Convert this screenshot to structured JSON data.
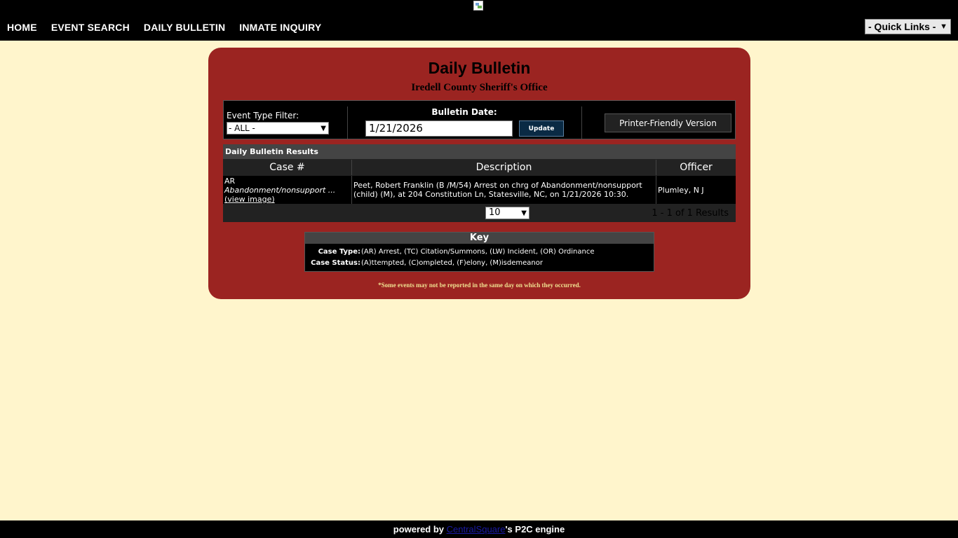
{
  "nav": {
    "items": [
      {
        "label": "HOME"
      },
      {
        "label": "EVENT SEARCH"
      },
      {
        "label": "DAILY BULLETIN"
      },
      {
        "label": "INMATE INQUIRY"
      }
    ],
    "quick_links": "- Quick Links -"
  },
  "panel": {
    "title": "Daily Bulletin",
    "subtitle": "Iredell County Sheriff's Office"
  },
  "filters": {
    "event_type_label": "Event Type Filter:",
    "event_type_value": "- ALL -",
    "bulletin_date_label": "Bulletin Date:",
    "bulletin_date_value": "1/21/2026",
    "update_label": "Update",
    "printer_label": "Printer-Friendly Version"
  },
  "results": {
    "title": "Daily Bulletin Results",
    "columns": [
      "Case #",
      "Description",
      "Officer"
    ],
    "rows": [
      {
        "case_code": "AR",
        "case_desc": "Abandonment/nonsupport ...",
        "case_link": "(view image)",
        "description": "Peet, Robert Franklin (B /M/54) Arrest on chrg of Abandonment/nonsupport (child) (M), at 204 Constitution Ln, Statesville, NC, on 1/21/2026 10:30.",
        "officer": "Plumley, N J"
      }
    ],
    "page_size": "10",
    "count_text": "1 - 1 of 1 Results"
  },
  "key": {
    "title": "Key",
    "case_type_label": "Case Type:",
    "case_type_value": "(AR) Arrest, (TC) Citation/Summons, (LW) Incident, (OR) Ordinance",
    "case_status_label": "Case Status:",
    "case_status_value": "(A)ttempted, (C)ompleted, (F)elony, (M)isdemeanor"
  },
  "note": "*Some events may not be reported in the same day on which they occurred.",
  "footer": {
    "prefix": "powered by ",
    "brand": "CentralSquare",
    "suffix": "'s P2C engine"
  },
  "colors": {
    "panel": "#9b2421",
    "background": "#fff5cc",
    "header": "#000000"
  }
}
